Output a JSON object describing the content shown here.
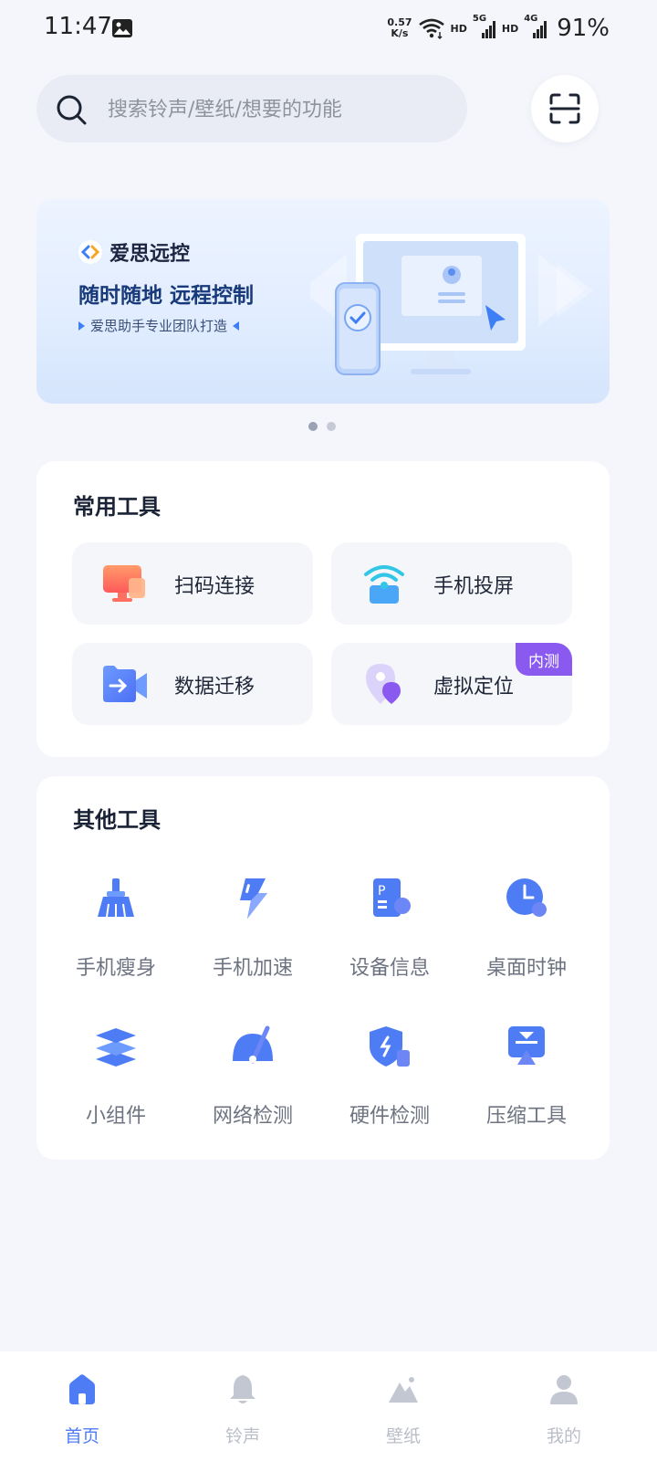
{
  "status_bar": {
    "time": "11:47",
    "net_speed_value": "0.57",
    "net_speed_unit": "K/s",
    "hd1": "HD",
    "net1": "5G",
    "hd2": "HD",
    "net2": "4G",
    "battery": "91%"
  },
  "search": {
    "placeholder": "搜索铃声/壁纸/想要的功能"
  },
  "banner": {
    "logo_text": "爱思远控",
    "headline": "随时随地 远程控制",
    "subtitle": "爱思助手专业团队打造",
    "page_count": 2,
    "active_page": 1
  },
  "common_tools": {
    "title": "常用工具",
    "items": [
      {
        "label": "扫码连接",
        "icon": "scan-connect-icon"
      },
      {
        "label": "手机投屏",
        "icon": "screen-mirror-icon"
      },
      {
        "label": "数据迁移",
        "icon": "data-migration-icon"
      },
      {
        "label": "虚拟定位",
        "icon": "virtual-location-icon",
        "badge": "内测"
      }
    ]
  },
  "other_tools": {
    "title": "其他工具",
    "items": [
      {
        "label": "手机瘦身",
        "icon": "broom-icon"
      },
      {
        "label": "手机加速",
        "icon": "lightning-icon"
      },
      {
        "label": "设备信息",
        "icon": "device-info-icon"
      },
      {
        "label": "桌面时钟",
        "icon": "clock-icon"
      },
      {
        "label": "小组件",
        "icon": "widget-layers-icon"
      },
      {
        "label": "网络检测",
        "icon": "speedometer-icon"
      },
      {
        "label": "硬件检测",
        "icon": "shield-icon"
      },
      {
        "label": "压缩工具",
        "icon": "compress-icon"
      }
    ]
  },
  "bottom_nav": {
    "items": [
      {
        "label": "首页",
        "icon": "home-icon",
        "active": true
      },
      {
        "label": "铃声",
        "icon": "bell-icon",
        "active": false
      },
      {
        "label": "壁纸",
        "icon": "mountain-icon",
        "active": false
      },
      {
        "label": "我的",
        "icon": "person-icon",
        "active": false
      }
    ]
  },
  "colors": {
    "accent": "#4d7cf5",
    "badge": "#8a59f0",
    "background": "#f4f6fb"
  }
}
